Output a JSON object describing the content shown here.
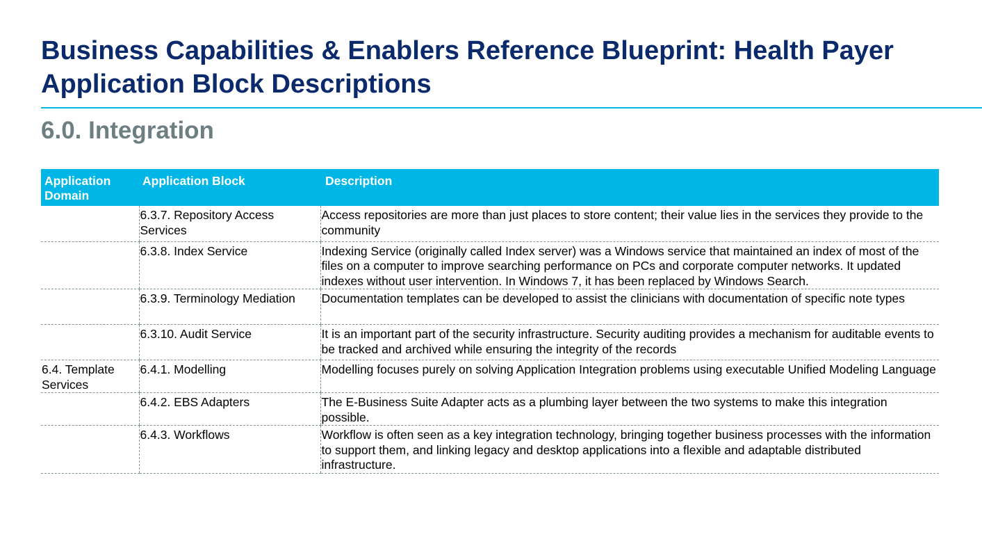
{
  "title": "Business Capabilities & Enablers Reference Blueprint: Health Payer Application Block Descriptions",
  "section": "6.0. Integration",
  "table": {
    "headers": {
      "domain": "Application Domain",
      "block": "Application Block",
      "description": "Description"
    },
    "rows": [
      {
        "domain": "",
        "block": "6.3.7. Repository Access Services",
        "description": "Access repositories are more than just places to store content; their value lies in the services they provide to the community"
      },
      {
        "domain": "",
        "block": "6.3.8. Index Service",
        "description": "Indexing Service (originally called Index server) was a Windows service that maintained an index of most of the files on a computer to improve searching performance on PCs and corporate computer networks. It updated indexes without user intervention. In Windows 7, it has been replaced by Windows Search."
      },
      {
        "domain": "",
        "block": "6.3.9. Terminology Mediation",
        "description": "Documentation templates can be developed to assist the clinicians with documentation of specific note types"
      },
      {
        "domain": "",
        "block": "6.3.10. Audit Service",
        "description": "It is an important part of the security infrastructure. Security auditing provides a mechanism for auditable events to be tracked and archived while ensuring the integrity of the records"
      },
      {
        "domain": "6.4. Template Services",
        "block": "6.4.1. Modelling",
        "description": "Modelling focuses purely on solving Application Integration problems using executable Unified Modeling Language"
      },
      {
        "domain": "",
        "block": "6.4.2. EBS Adapters",
        "description": "The E-Business Suite Adapter acts as a plumbing layer between the two systems to make this integration possible."
      },
      {
        "domain": "",
        "block": "6.4.3. Workflows",
        "description": "Workflow is often seen as a key integration technology, bringing together business processes with the information to support them, and linking legacy and desktop applications into a flexible and adaptable distributed infrastructure."
      }
    ]
  }
}
